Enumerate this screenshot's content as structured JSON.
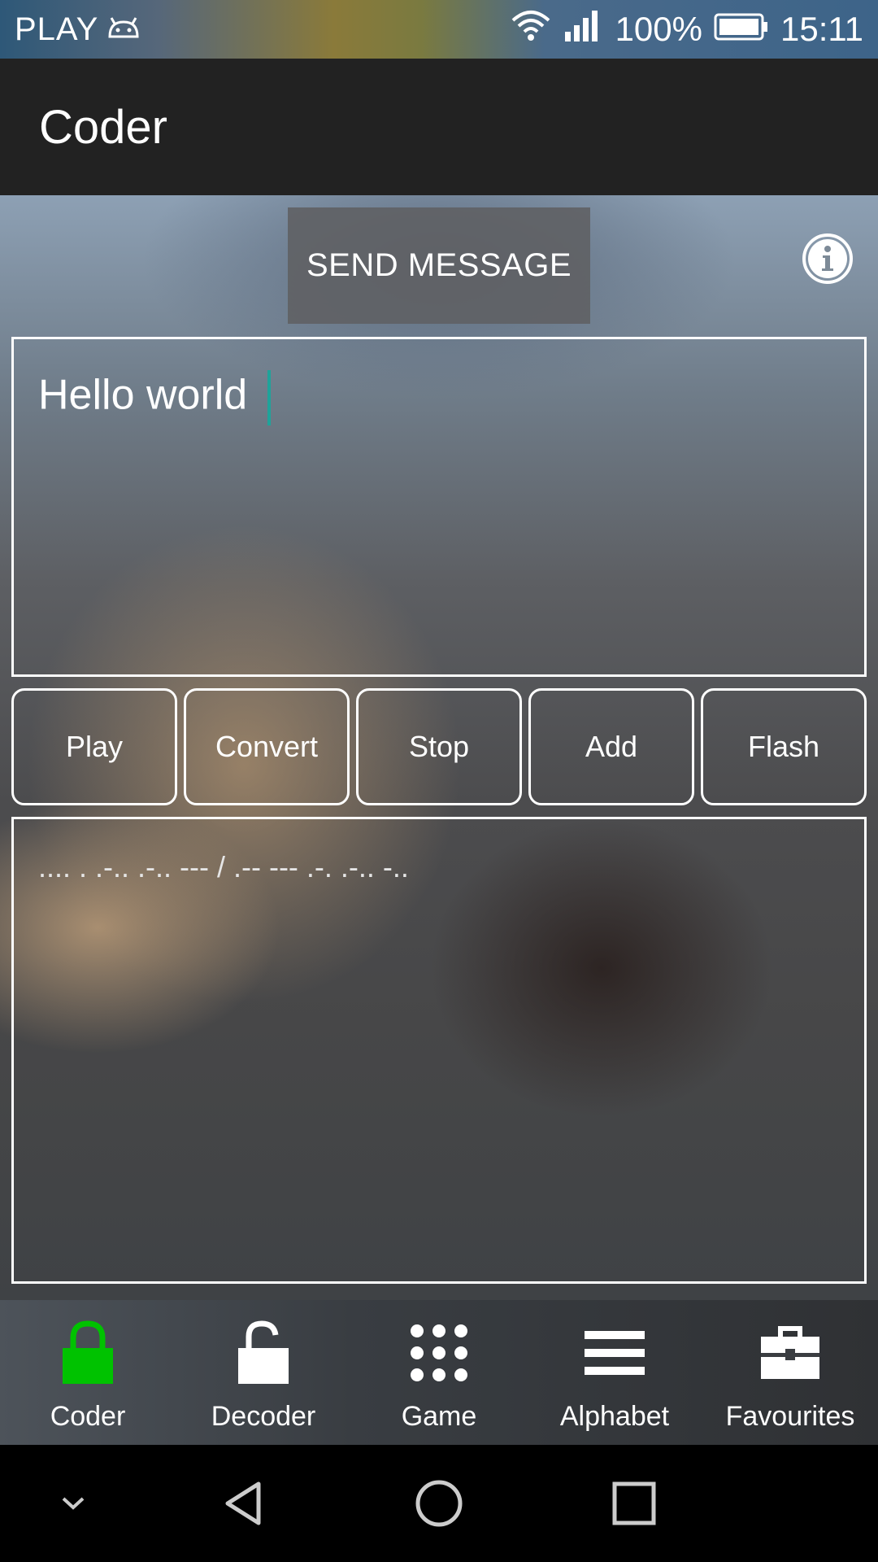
{
  "status_bar": {
    "carrier": "PLAY",
    "battery": "100%",
    "time": "15:11",
    "icons": [
      "android-icon",
      "wifi-icon",
      "signal-icon",
      "battery-icon"
    ]
  },
  "app_bar": {
    "title": "Coder"
  },
  "actions": {
    "send_label": "SEND MESSAGE",
    "info_icon": "info-icon"
  },
  "input": {
    "value": "Hello world "
  },
  "controls": [
    "Play",
    "Convert",
    "Stop",
    "Add",
    "Flash"
  ],
  "output": {
    "value": ".... . .-.. .-.. --- / .-- --- .-. .-.. -.."
  },
  "bottom_nav": {
    "active_color": "#00c200",
    "items": [
      {
        "label": "Coder",
        "icon": "lock-closed-icon"
      },
      {
        "label": "Decoder",
        "icon": "lock-open-icon"
      },
      {
        "label": "Game",
        "icon": "grid-dots-icon"
      },
      {
        "label": "Alphabet",
        "icon": "list-icon"
      },
      {
        "label": "Favourites",
        "icon": "briefcase-icon"
      }
    ]
  },
  "system_nav": [
    "collapse-icon",
    "back-icon",
    "home-icon",
    "recents-icon"
  ]
}
